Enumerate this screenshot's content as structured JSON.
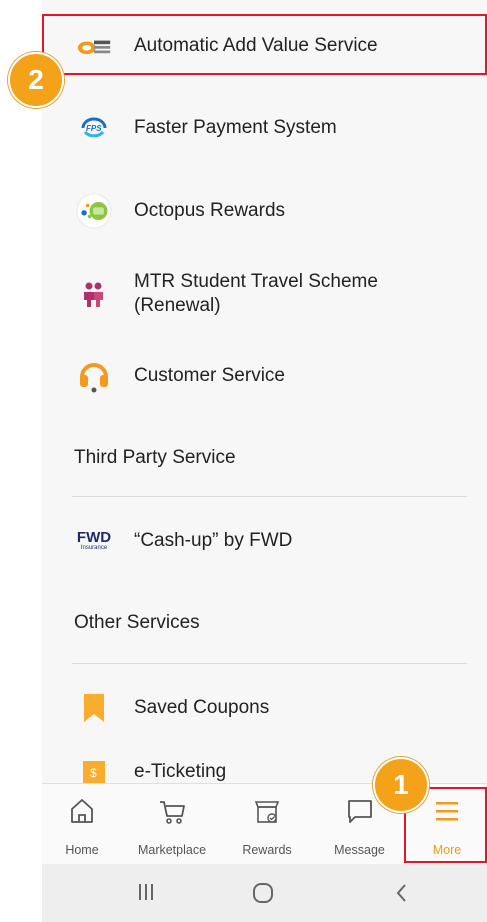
{
  "menu": {
    "items": [
      {
        "label": "Automatic Add Value Service",
        "icon": "aavs-icon"
      },
      {
        "label": "Faster Payment System",
        "icon": "fps-icon"
      },
      {
        "label": "Octopus Rewards",
        "icon": "octopus-rewards-icon"
      },
      {
        "label": "MTR Student Travel Scheme",
        "label2": "(Renewal)",
        "icon": "mtr-student-icon"
      },
      {
        "label": "Customer Service",
        "icon": "headset-icon"
      }
    ],
    "third_party_heading": "Third Party Service",
    "third_party_items": [
      {
        "label": "“Cash-up” by FWD",
        "icon": "fwd-logo-icon",
        "logo_text": "FWD",
        "logo_sub": "Insurance"
      }
    ],
    "other_heading": "Other Services",
    "other_items": [
      {
        "label": "Saved Coupons",
        "icon": "bookmark-icon"
      },
      {
        "label": "e-Ticketing",
        "icon": "ticket-icon"
      }
    ]
  },
  "tabbar": {
    "tabs": [
      {
        "label": "Home",
        "icon": "home-icon"
      },
      {
        "label": "Marketplace",
        "icon": "cart-icon"
      },
      {
        "label": "Rewards",
        "icon": "rewards-icon"
      },
      {
        "label": "Message",
        "icon": "message-icon"
      },
      {
        "label": "More",
        "icon": "menu-icon",
        "active": true
      }
    ]
  },
  "annotations": {
    "badge_1": "1",
    "badge_2": "2"
  },
  "colors": {
    "accent": "#f29a1d",
    "highlight": "#e4142a",
    "badge": "#f4a21a"
  }
}
